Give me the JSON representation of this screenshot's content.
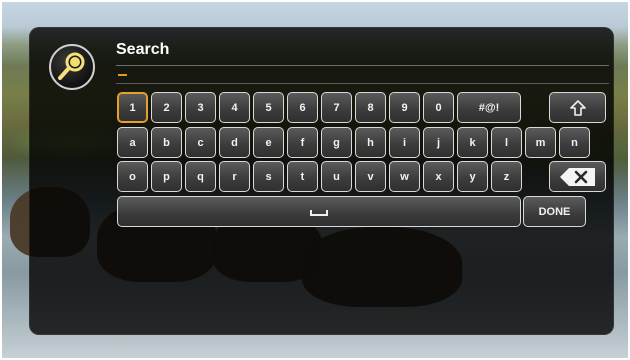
{
  "dialog": {
    "title": "Search",
    "input_value": ""
  },
  "icons": {
    "search": "search-icon",
    "shift": "shift-icon",
    "backspace": "backspace-icon",
    "space": "space-icon"
  },
  "keyboard": {
    "row1": [
      "1",
      "2",
      "3",
      "4",
      "5",
      "6",
      "7",
      "8",
      "9",
      "0",
      "#@!"
    ],
    "row2": [
      "a",
      "b",
      "c",
      "d",
      "e",
      "f",
      "g",
      "h",
      "i",
      "j",
      "k",
      "l",
      "m",
      "n"
    ],
    "row3": [
      "o",
      "p",
      "q",
      "r",
      "s",
      "t",
      "u",
      "v",
      "w",
      "x",
      "y",
      "z"
    ],
    "done_label": "DONE",
    "focused_key": "1"
  },
  "colors": {
    "accent": "#e6a12a",
    "key_border": "#d9d9d9"
  }
}
